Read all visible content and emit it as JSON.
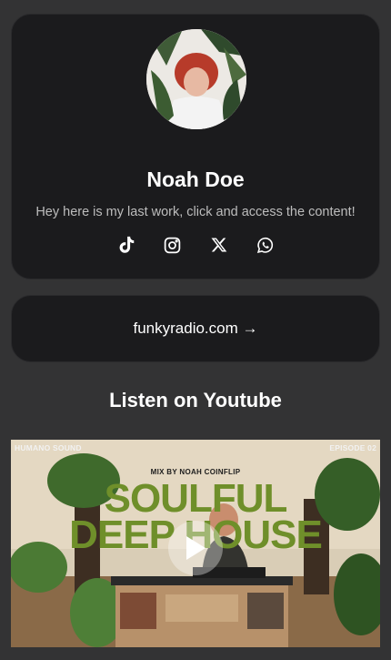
{
  "profile": {
    "name": "Noah Doe",
    "bio": "Hey here is my last work, click and access the content!",
    "socials": [
      {
        "icon": "tiktok-icon"
      },
      {
        "icon": "instagram-icon"
      },
      {
        "icon": "x-icon"
      },
      {
        "icon": "whatsapp-icon"
      }
    ]
  },
  "link": {
    "label": "funkyradio.com →"
  },
  "youtube": {
    "title": "Listen on Youtube",
    "thumbnail": {
      "brand": "HUMANO SOUND",
      "episode": "EPISODE 02",
      "mix_by": "MIX BY NOAH COINFLIP",
      "headline_line1": "SOULFUL",
      "headline_line2": "DEEP HOUSE"
    }
  },
  "colors": {
    "background": "#333334",
    "card": "#1b1b1d",
    "headline_green": "#6f8f2a"
  }
}
